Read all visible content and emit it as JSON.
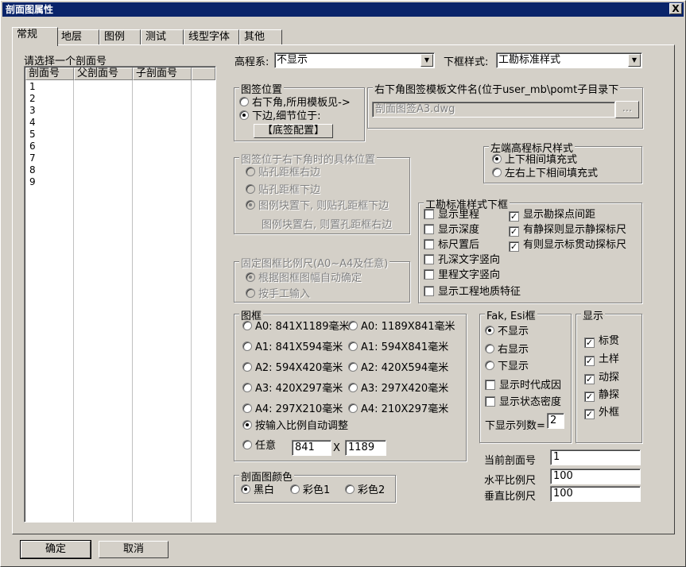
{
  "window": {
    "title": "剖面图属性",
    "close": "X"
  },
  "tabs": [
    "常规",
    "地层",
    "图例",
    "测试",
    "线型字体",
    "其他"
  ],
  "list": {
    "label": "请选择一个剖面号",
    "columns": [
      "剖面号",
      "父剖面号",
      "子剖面号"
    ],
    "rows": [
      "1",
      "2",
      "3",
      "4",
      "5",
      "6",
      "7",
      "8",
      "9"
    ]
  },
  "elev": {
    "label": "高程系:",
    "value": "不显示"
  },
  "frame_style": {
    "label": "下框样式:",
    "value": "工勘标准样式"
  },
  "sig_pos": {
    "title": "图签位置",
    "opt1": "右下角,所用模板见->",
    "opt2": "下边,细节位于:",
    "button": "【底签配置】"
  },
  "template": {
    "title": "右下角图签模板文件名(位于user_mb\\pomt子目录下",
    "value": "剖面图签A3.dwg",
    "browse": "..."
  },
  "ruler": {
    "title": "左端高程标尺样式",
    "opt1": "上下相间填充式",
    "opt2": "左右上下相间填充式"
  },
  "corner_pos": {
    "title": "图签位于右下角时的具体位置",
    "opt1": "贴孔距框右边",
    "opt2": "贴孔距框下边",
    "opt3a": "图例块置下, 则贴孔距框下边",
    "opt3b": "图例块置右, 则置孔距框右边"
  },
  "gk_frame": {
    "title": "工勘标准样式下框",
    "items": [
      {
        "label": "显示里程",
        "checked": false
      },
      {
        "label": "显示勘探点间距",
        "checked": true
      },
      {
        "label": "显示深度",
        "checked": false
      },
      {
        "label": "有静探则显示静探标尺",
        "checked": true
      },
      {
        "label": "标尺置后",
        "checked": false
      },
      {
        "label": "有则显示标贯动探标尺",
        "checked": true
      },
      {
        "label": "孔深文字竖向",
        "checked": false
      },
      {
        "label": "里程文字竖向",
        "checked": false
      },
      {
        "label": "显示工程地质特征",
        "checked": false
      }
    ]
  },
  "fixed_scale": {
    "title": "固定图框比例尺(A0~A4及任意)",
    "opt1": "根据图框图幅自动确定",
    "opt2": "按手工输入"
  },
  "tukuang": {
    "title": "图框",
    "sizes": [
      [
        "A0: 841X1189毫米",
        "A0: 1189X841毫米"
      ],
      [
        "A1: 841X594毫米",
        "A1: 594X841毫米"
      ],
      [
        "A2: 594X420毫米",
        "A2: 420X594毫米"
      ],
      [
        "A3: 420X297毫米",
        "A3: 297X420毫米"
      ],
      [
        "A4: 297X210毫米",
        "A4: 210X297毫米"
      ]
    ],
    "auto": "按输入比例自动调整",
    "custom": "任意",
    "w": "841",
    "x": "X",
    "h": "1189"
  },
  "fak": {
    "title": "Fak, Esi框",
    "opt1": "不显示",
    "opt2": "右显示",
    "opt3": "下显示",
    "cb1": "显示时代成因",
    "cb2": "显示状态密度",
    "cols_label": "下显示列数=",
    "cols": "2"
  },
  "display": {
    "title": "显示",
    "items": [
      "标贯",
      "土样",
      "动探",
      "静探",
      "外框"
    ]
  },
  "fields": {
    "cur_label": "当前剖面号",
    "cur": "1",
    "h_label": "水平比例尺",
    "h": "100",
    "v_label": "垂直比例尺",
    "v": "100"
  },
  "color": {
    "title": "剖面图颜色",
    "opt1": "黑白",
    "opt2": "彩色1",
    "opt3": "彩色2"
  },
  "buttons": {
    "ok": "确定",
    "cancel": "取消"
  }
}
